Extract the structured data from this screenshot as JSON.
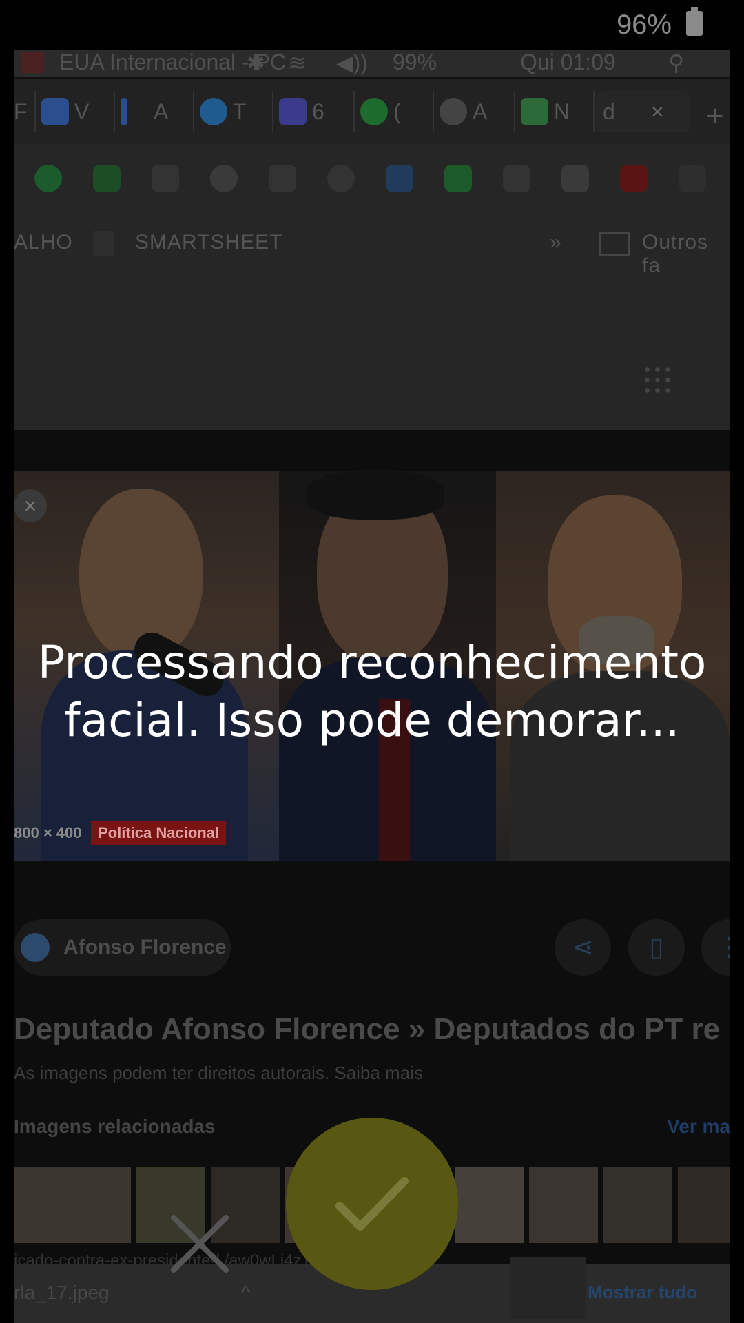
{
  "phone_status": {
    "battery": "96%"
  },
  "capture": {
    "window_bar": {
      "title": "EUA Internacional - PC",
      "volume": "99%",
      "clock": "Qui 01:09"
    },
    "tabs": [
      {
        "label": "F",
        "color": "#3a3a3a"
      },
      {
        "label": "V",
        "color": "#2a4e8e"
      },
      {
        "label": "A",
        "color": "#2a4e8e"
      },
      {
        "label": "T",
        "color": "#1f5b8e"
      },
      {
        "label": "6",
        "color": "#3c3a8a"
      },
      {
        "label": "(",
        "color": "#1e6b2e"
      },
      {
        "label": "A",
        "color": "#444444"
      },
      {
        "label": "N",
        "color": "#2d6a3a"
      },
      {
        "label": "d",
        "color": "#262626"
      }
    ],
    "tab_new": "+",
    "tab_close": "×",
    "bookmarks": {
      "first": "ALHO",
      "second": "SMARTSHEET",
      "more": "»",
      "folder": "Outros fa"
    },
    "image": {
      "size": "800 × 400",
      "tag": "Política Nacional"
    },
    "result": {
      "source": "Afonso Florence",
      "title": "Deputado Afonso Florence » Deputados do PT re",
      "copyright": "As imagens podem ter direitos autorais. Saiba mais",
      "related_title": "Imagens relacionadas",
      "related_more": "Ver ma",
      "url_line": "icado-contra-ex-presidente-l                  /aw0wLj4zT9oIlRJv2fup8Yq..."
    },
    "download": {
      "file": "rla_17.jpeg",
      "show_all": "Mostrar tudo"
    }
  },
  "overlay": {
    "message_line1": "Processando reconhecimento",
    "message_line2": "facial. Isso pode demorar..."
  },
  "colors": {
    "confirm": "#585812",
    "overlay_text": "#ffffff"
  }
}
